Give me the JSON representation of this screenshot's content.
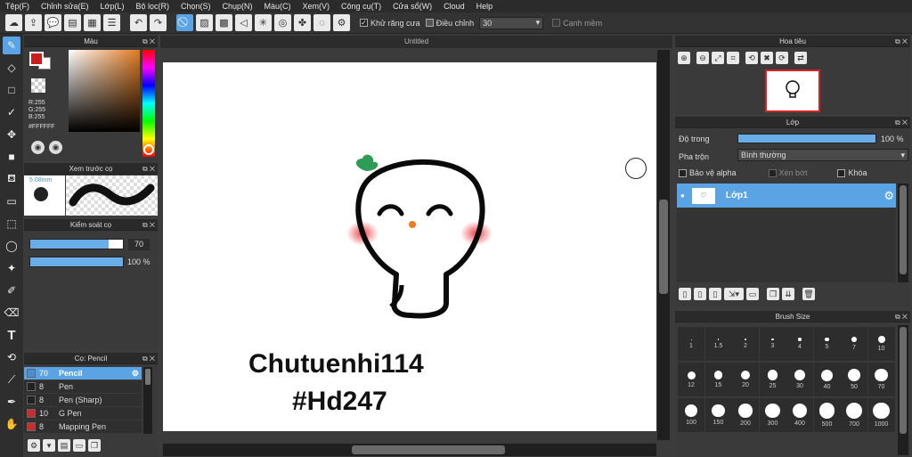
{
  "menu": [
    "Tệp(F)",
    "Chỉnh sửa(E)",
    "Lớp(L)",
    "Bộ lọc(R)",
    "Chọn(S)",
    "Chụp(N)",
    "Màu(C)",
    "Xem(V)",
    "Công cụ(T)",
    "Cửa sổ(W)",
    "Cloud",
    "Help"
  ],
  "toolbar": {
    "antialias_label": "Khử răng cưa",
    "adjust_label": "Điều chỉnh",
    "adjust_value": "30",
    "smooth_edge_label": "Cạnh mềm"
  },
  "color_panel": {
    "title": "Màu",
    "r": "R:255",
    "g": "G:255",
    "b": "B:255",
    "hex": "#FFFFFF",
    "primary": "#cc1d1d",
    "secondary": "#ffffff"
  },
  "brush_preview": {
    "title": "Xem trước cọ",
    "size": "5.08mm"
  },
  "brush_control": {
    "title": "Kiểm soát cọ",
    "size_value": "70",
    "opacity_value": "100 %",
    "size_fraction": 0.85,
    "opacity_fraction": 1.0
  },
  "brush_list": {
    "title": "Cọ: Pencil",
    "items": [
      {
        "size": "70",
        "name": "Pencil",
        "color": "#4a8ed6",
        "selected": true
      },
      {
        "size": "8",
        "name": "Pen",
        "color": "#222222",
        "selected": false
      },
      {
        "size": "8",
        "name": "Pen (Sharp)",
        "color": "#222222",
        "selected": false
      },
      {
        "size": "10",
        "name": "G Pen",
        "color": "#d12a2a",
        "selected": false
      },
      {
        "size": "8",
        "name": "Mapping Pen",
        "color": "#d12a2a",
        "selected": false
      }
    ]
  },
  "canvas": {
    "tab_title": "Untitled",
    "text_line1": "Chutuenhi114",
    "text_line2": "#Hd247"
  },
  "navigator": {
    "title": "Hoa tiêu"
  },
  "layers": {
    "title": "Lớp",
    "opacity_label": "Độ trong",
    "opacity_value": "100 %",
    "opacity_fraction": 1.0,
    "blend_label": "Pha trộn",
    "blend_value": "Bình thường",
    "protect_alpha": "Bảo vệ alpha",
    "clipping": "Xén bớt",
    "lock": "Khóa",
    "layer_name": "Lớp1"
  },
  "brush_size": {
    "title": "Brush Size",
    "sizes": [
      "1",
      "1.5",
      "2",
      "3",
      "4",
      "5",
      "7",
      "10",
      "12",
      "15",
      "20",
      "25",
      "30",
      "40",
      "50",
      "70",
      "100",
      "150",
      "200",
      "300",
      "400",
      "500",
      "700",
      "1000"
    ]
  }
}
